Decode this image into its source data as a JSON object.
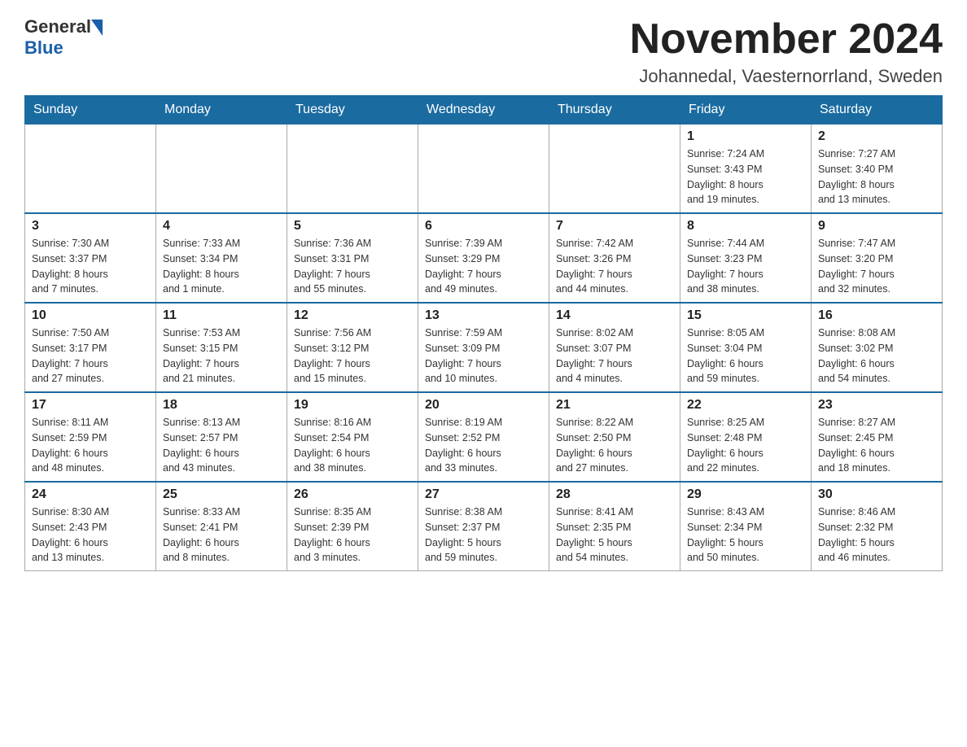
{
  "header": {
    "logo_general": "General",
    "logo_blue": "Blue",
    "month_title": "November 2024",
    "location": "Johannedal, Vaesternorrland, Sweden"
  },
  "weekdays": [
    "Sunday",
    "Monday",
    "Tuesday",
    "Wednesday",
    "Thursday",
    "Friday",
    "Saturday"
  ],
  "weeks": [
    [
      {
        "day": "",
        "info": ""
      },
      {
        "day": "",
        "info": ""
      },
      {
        "day": "",
        "info": ""
      },
      {
        "day": "",
        "info": ""
      },
      {
        "day": "",
        "info": ""
      },
      {
        "day": "1",
        "info": "Sunrise: 7:24 AM\nSunset: 3:43 PM\nDaylight: 8 hours\nand 19 minutes."
      },
      {
        "day": "2",
        "info": "Sunrise: 7:27 AM\nSunset: 3:40 PM\nDaylight: 8 hours\nand 13 minutes."
      }
    ],
    [
      {
        "day": "3",
        "info": "Sunrise: 7:30 AM\nSunset: 3:37 PM\nDaylight: 8 hours\nand 7 minutes."
      },
      {
        "day": "4",
        "info": "Sunrise: 7:33 AM\nSunset: 3:34 PM\nDaylight: 8 hours\nand 1 minute."
      },
      {
        "day": "5",
        "info": "Sunrise: 7:36 AM\nSunset: 3:31 PM\nDaylight: 7 hours\nand 55 minutes."
      },
      {
        "day": "6",
        "info": "Sunrise: 7:39 AM\nSunset: 3:29 PM\nDaylight: 7 hours\nand 49 minutes."
      },
      {
        "day": "7",
        "info": "Sunrise: 7:42 AM\nSunset: 3:26 PM\nDaylight: 7 hours\nand 44 minutes."
      },
      {
        "day": "8",
        "info": "Sunrise: 7:44 AM\nSunset: 3:23 PM\nDaylight: 7 hours\nand 38 minutes."
      },
      {
        "day": "9",
        "info": "Sunrise: 7:47 AM\nSunset: 3:20 PM\nDaylight: 7 hours\nand 32 minutes."
      }
    ],
    [
      {
        "day": "10",
        "info": "Sunrise: 7:50 AM\nSunset: 3:17 PM\nDaylight: 7 hours\nand 27 minutes."
      },
      {
        "day": "11",
        "info": "Sunrise: 7:53 AM\nSunset: 3:15 PM\nDaylight: 7 hours\nand 21 minutes."
      },
      {
        "day": "12",
        "info": "Sunrise: 7:56 AM\nSunset: 3:12 PM\nDaylight: 7 hours\nand 15 minutes."
      },
      {
        "day": "13",
        "info": "Sunrise: 7:59 AM\nSunset: 3:09 PM\nDaylight: 7 hours\nand 10 minutes."
      },
      {
        "day": "14",
        "info": "Sunrise: 8:02 AM\nSunset: 3:07 PM\nDaylight: 7 hours\nand 4 minutes."
      },
      {
        "day": "15",
        "info": "Sunrise: 8:05 AM\nSunset: 3:04 PM\nDaylight: 6 hours\nand 59 minutes."
      },
      {
        "day": "16",
        "info": "Sunrise: 8:08 AM\nSunset: 3:02 PM\nDaylight: 6 hours\nand 54 minutes."
      }
    ],
    [
      {
        "day": "17",
        "info": "Sunrise: 8:11 AM\nSunset: 2:59 PM\nDaylight: 6 hours\nand 48 minutes."
      },
      {
        "day": "18",
        "info": "Sunrise: 8:13 AM\nSunset: 2:57 PM\nDaylight: 6 hours\nand 43 minutes."
      },
      {
        "day": "19",
        "info": "Sunrise: 8:16 AM\nSunset: 2:54 PM\nDaylight: 6 hours\nand 38 minutes."
      },
      {
        "day": "20",
        "info": "Sunrise: 8:19 AM\nSunset: 2:52 PM\nDaylight: 6 hours\nand 33 minutes."
      },
      {
        "day": "21",
        "info": "Sunrise: 8:22 AM\nSunset: 2:50 PM\nDaylight: 6 hours\nand 27 minutes."
      },
      {
        "day": "22",
        "info": "Sunrise: 8:25 AM\nSunset: 2:48 PM\nDaylight: 6 hours\nand 22 minutes."
      },
      {
        "day": "23",
        "info": "Sunrise: 8:27 AM\nSunset: 2:45 PM\nDaylight: 6 hours\nand 18 minutes."
      }
    ],
    [
      {
        "day": "24",
        "info": "Sunrise: 8:30 AM\nSunset: 2:43 PM\nDaylight: 6 hours\nand 13 minutes."
      },
      {
        "day": "25",
        "info": "Sunrise: 8:33 AM\nSunset: 2:41 PM\nDaylight: 6 hours\nand 8 minutes."
      },
      {
        "day": "26",
        "info": "Sunrise: 8:35 AM\nSunset: 2:39 PM\nDaylight: 6 hours\nand 3 minutes."
      },
      {
        "day": "27",
        "info": "Sunrise: 8:38 AM\nSunset: 2:37 PM\nDaylight: 5 hours\nand 59 minutes."
      },
      {
        "day": "28",
        "info": "Sunrise: 8:41 AM\nSunset: 2:35 PM\nDaylight: 5 hours\nand 54 minutes."
      },
      {
        "day": "29",
        "info": "Sunrise: 8:43 AM\nSunset: 2:34 PM\nDaylight: 5 hours\nand 50 minutes."
      },
      {
        "day": "30",
        "info": "Sunrise: 8:46 AM\nSunset: 2:32 PM\nDaylight: 5 hours\nand 46 minutes."
      }
    ]
  ]
}
